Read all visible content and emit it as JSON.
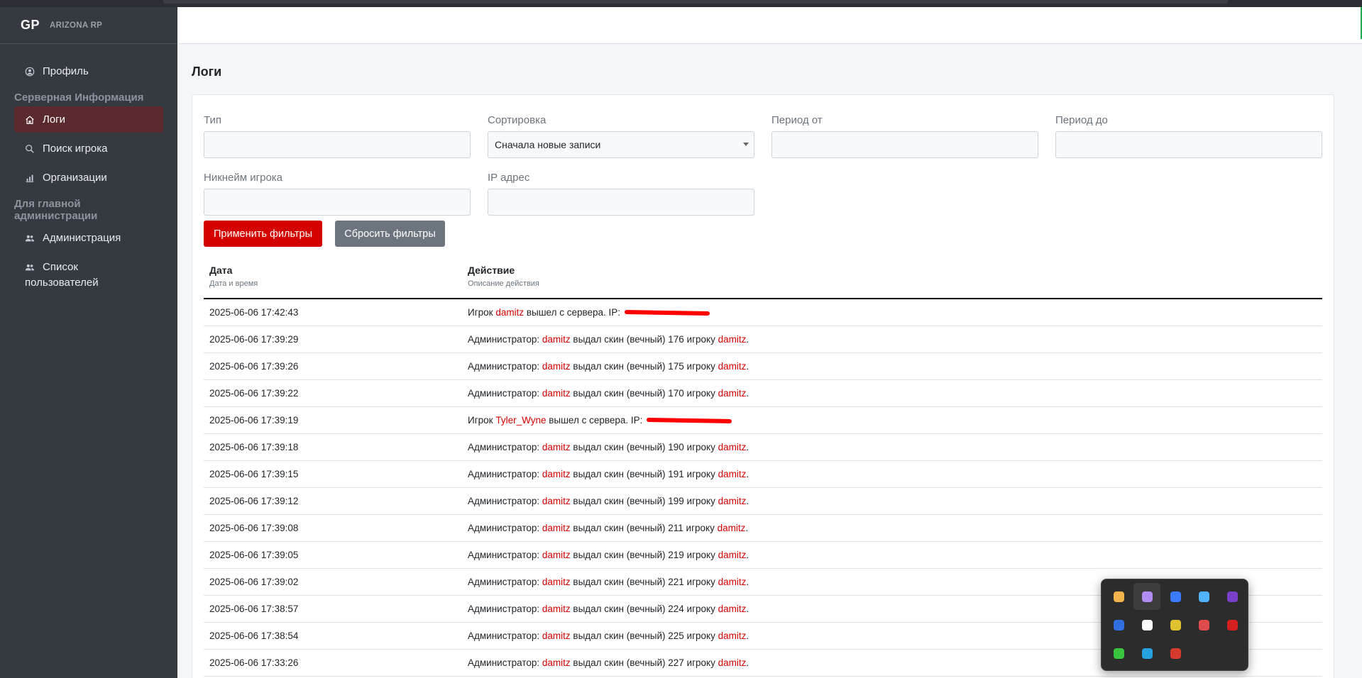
{
  "brand": {
    "logo": "GP",
    "name": "ARIZONA RP"
  },
  "sidebar": {
    "profile": "Профиль",
    "section_server": "Серверная Информация",
    "logs": "Логи",
    "player_search": "Поиск игрока",
    "organizations": "Организации",
    "section_admin": "Для главной администрации",
    "administration": "Администрация",
    "users_line1": "Список",
    "users_line2": "пользователей"
  },
  "page": {
    "title": "Логи"
  },
  "filters": {
    "type_label": "Тип",
    "type_value": "",
    "sort_label": "Сортировка",
    "sort_value": "Сначала новые записи",
    "period_from_label": "Период от",
    "period_from_value": "",
    "period_to_label": "Период до",
    "period_to_value": "",
    "nickname_label": "Никнейм игрока",
    "nickname_value": "",
    "ip_label": "IP адрес",
    "ip_value": "",
    "apply_button": "Применить фильтры",
    "reset_button": "Сбросить фильтры"
  },
  "table": {
    "col_date": "Дата",
    "col_date_sub": "Дата и время",
    "col_action": "Действие",
    "col_action_sub": "Описание действия",
    "rows": [
      {
        "date": "2025-06-06 17:42:43",
        "pre": "Игрок ",
        "nick1": "damitz",
        "mid": " вышел с сервера. IP: ",
        "nick2": "",
        "post": "",
        "redacted": true
      },
      {
        "date": "2025-06-06 17:39:29",
        "pre": "Администратор: ",
        "nick1": "damitz",
        "mid": " выдал скин (вечный) 176 игроку ",
        "nick2": "damitz",
        "post": ".",
        "redacted": false
      },
      {
        "date": "2025-06-06 17:39:26",
        "pre": "Администратор: ",
        "nick1": "damitz",
        "mid": " выдал скин (вечный) 175 игроку ",
        "nick2": "damitz",
        "post": ".",
        "redacted": false
      },
      {
        "date": "2025-06-06 17:39:22",
        "pre": "Администратор: ",
        "nick1": "damitz",
        "mid": " выдал скин (вечный) 170 игроку ",
        "nick2": "damitz",
        "post": ".",
        "redacted": false
      },
      {
        "date": "2025-06-06 17:39:19",
        "pre": "Игрок ",
        "nick1": "Tyler_Wyne",
        "mid": " вышел с сервера. IP: ",
        "nick2": "",
        "post": "",
        "redacted": true
      },
      {
        "date": "2025-06-06 17:39:18",
        "pre": "Администратор: ",
        "nick1": "damitz",
        "mid": " выдал скин (вечный) 190 игроку ",
        "nick2": "damitz",
        "post": ".",
        "redacted": false
      },
      {
        "date": "2025-06-06 17:39:15",
        "pre": "Администратор: ",
        "nick1": "damitz",
        "mid": " выдал скин (вечный) 191 игроку ",
        "nick2": "damitz",
        "post": ".",
        "redacted": false
      },
      {
        "date": "2025-06-06 17:39:12",
        "pre": "Администратор: ",
        "nick1": "damitz",
        "mid": " выдал скин (вечный) 199 игроку ",
        "nick2": "damitz",
        "post": ".",
        "redacted": false
      },
      {
        "date": "2025-06-06 17:39:08",
        "pre": "Администратор: ",
        "nick1": "damitz",
        "mid": " выдал скин (вечный) 211 игроку ",
        "nick2": "damitz",
        "post": ".",
        "redacted": false
      },
      {
        "date": "2025-06-06 17:39:05",
        "pre": "Администратор: ",
        "nick1": "damitz",
        "mid": " выдал скин (вечный) 219 игроку ",
        "nick2": "damitz",
        "post": ".",
        "redacted": false
      },
      {
        "date": "2025-06-06 17:39:02",
        "pre": "Администратор: ",
        "nick1": "damitz",
        "mid": " выдал скин (вечный) 221 игроку ",
        "nick2": "damitz",
        "post": ".",
        "redacted": false
      },
      {
        "date": "2025-06-06 17:38:57",
        "pre": "Администратор: ",
        "nick1": "damitz",
        "mid": " выдал скин (вечный) 224 игроку ",
        "nick2": "damitz",
        "post": ".",
        "redacted": false
      },
      {
        "date": "2025-06-06 17:38:54",
        "pre": "Администратор: ",
        "nick1": "damitz",
        "mid": " выдал скин (вечный) 225 игроку ",
        "nick2": "damitz",
        "post": ".",
        "redacted": false
      },
      {
        "date": "2025-06-06 17:33:26",
        "pre": "Администратор: ",
        "nick1": "damitz",
        "mid": " выдал скин (вечный) 227 игроку ",
        "nick2": "damitz",
        "post": ".",
        "redacted": false
      }
    ]
  },
  "tray": {
    "icons": [
      {
        "name": "drop-app-icon",
        "color": "#f2b24c"
      },
      {
        "name": "feather-app-icon",
        "color": "#b28cf0"
      },
      {
        "name": "malwarebytes-icon",
        "color": "#3a7bff"
      },
      {
        "name": "copilot-icon",
        "color": "#4fb3ff"
      },
      {
        "name": "onenote-icon",
        "color": "#7a3fc9"
      },
      {
        "name": "clock-app-icon",
        "color": "#2f6fe0"
      },
      {
        "name": "telegram-icon",
        "color": "#ffffff"
      },
      {
        "name": "layers-app-icon",
        "color": "#e0c230"
      },
      {
        "name": "ring-app-icon",
        "color": "#e04b4b"
      },
      {
        "name": "microphone-icon",
        "color": "#d61f1f"
      },
      {
        "name": "xbox-icon",
        "color": "#39c440"
      },
      {
        "name": "defender-icon",
        "color": "#27a2e0"
      },
      {
        "name": "mail-alert-icon",
        "color": "#d63a2f"
      }
    ]
  }
}
